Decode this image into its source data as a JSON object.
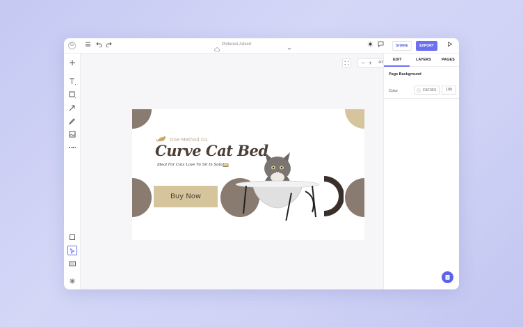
{
  "topbar": {
    "doc_title": "Pinterest Advert",
    "share_label": "SHARE",
    "export_label": "EXPORT",
    "icons": [
      "menu-icon",
      "undo-icon",
      "redo-icon",
      "sun-icon",
      "comment-icon",
      "play-icon"
    ]
  },
  "canvas": {
    "zoom": "40%",
    "zoom_minus": "−",
    "zoom_plus": "+"
  },
  "artboard": {
    "background": "#F6F3F6",
    "brand": "One Method Co.",
    "headline": "Curve Cat Bed",
    "tagline": "Ideal For Cats Love To Sit In Sofa!",
    "button": "Buy Now",
    "accent_tan": "#D6C49C",
    "accent_brown": "#8A7B70"
  },
  "rightpanel": {
    "tabs": [
      "EDIT",
      "LAYERS",
      "PAGES"
    ],
    "active_tab": "EDIT",
    "section_title": "Page Background",
    "color_label": "Color",
    "color_hex": "F6F3F6",
    "opacity": "100"
  },
  "colors": {
    "accent": "#6B70F0",
    "panel_border": "#ECECF0"
  }
}
